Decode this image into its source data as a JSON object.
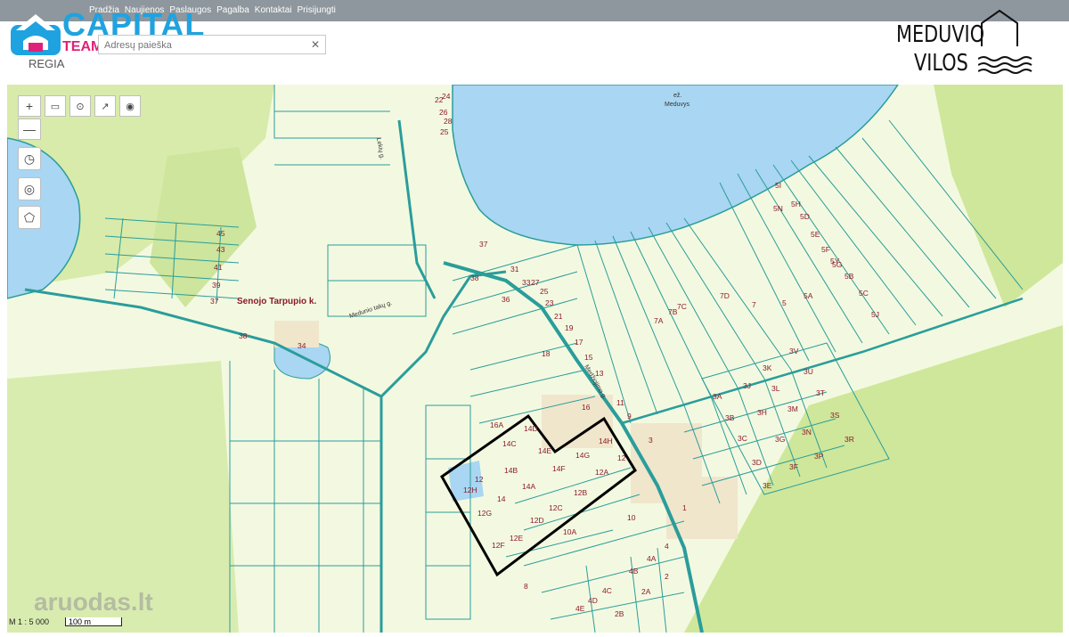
{
  "nav": {
    "items": [
      "Pradžia",
      "Naujienos",
      "Paslaugos",
      "Pagalba",
      "Kontaktai",
      "Prisijungti"
    ]
  },
  "logo": {
    "word": "CAPITAL",
    "team": "TEAM",
    "sub": "REGIA"
  },
  "search": {
    "placeholder": "Adresų paieška",
    "clear": "✕"
  },
  "brand": {
    "line1": "MEDUVIO",
    "line2": "VILOS"
  },
  "map": {
    "lake_name": "ež.\nMeduvys",
    "lake_name_line1": "ež.",
    "lake_name_line2": "Meduvys",
    "village": "Senojo Tarpupio k.",
    "street_1": "Medunio takų g.",
    "street_2": "Lekių g.",
    "street_3": "Medžiojimo g.",
    "scale_text": "M 1 : 5 000",
    "scale_bar": "100 m",
    "watermark": "aruodas.lt",
    "colors": {
      "parcel": "#2a9d9b",
      "forest": "#d4e8a8",
      "water": "#a9d6f2",
      "boundary": "#000000",
      "plot_label": "#8b1a2a"
    }
  },
  "controls": {
    "zoom_in": "+",
    "zoom_out": "—",
    "rotate": "◷",
    "locate": "◎",
    "region": "⬠"
  },
  "labels": [
    "45",
    "43",
    "41",
    "39",
    "37",
    "38",
    "34",
    "36",
    "31",
    "33",
    "27",
    "25",
    "23",
    "21",
    "19",
    "17",
    "15",
    "13",
    "11",
    "9",
    "18",
    "16",
    "16A",
    "14D",
    "14C",
    "14E",
    "14F",
    "14G",
    "14H",
    "14B",
    "14A",
    "12",
    "12A",
    "12B",
    "12C",
    "12D",
    "12E",
    "12F",
    "12G",
    "12H",
    "14",
    "10",
    "10A",
    "8",
    "4",
    "4A",
    "4B",
    "4C",
    "4D",
    "4E",
    "2",
    "2A",
    "2B",
    "3",
    "1",
    "3A",
    "3B",
    "3C",
    "3D",
    "3E",
    "3F",
    "3G",
    "3H",
    "3J",
    "3K",
    "3L",
    "3M",
    "3N",
    "3P",
    "3R",
    "3S",
    "3T",
    "3U",
    "3V",
    "5",
    "5A",
    "5B",
    "5C",
    "5D",
    "5E",
    "5F",
    "5G",
    "5H",
    "5I",
    "5J",
    "5N",
    "5Y",
    "7",
    "7A",
    "7B",
    "7C",
    "7D",
    "22",
    "24",
    "26",
    "28",
    "25"
  ]
}
